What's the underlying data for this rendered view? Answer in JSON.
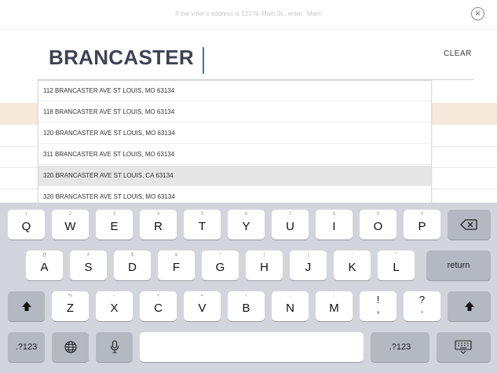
{
  "hint": {
    "text": "If the voter's address is 123 N. Main St., enter: 'Main'"
  },
  "search": {
    "value": "BRANCASTER",
    "clear_label": "CLEAR"
  },
  "suggestions": [
    "112 BRANCASTER AVE ST LOUIS, MO 63134",
    "118 BRANCASTER AVE ST LOUIS, MO 63134",
    "120 BRANCASTER AVE ST LOUIS, MO 63134",
    "311 BRANCASTER AVE ST LOUIS, MO 63134",
    "320 BRANCASTER AVE ST LOUIS, CA 63134",
    "320 BRANCASTER AVE ST LOUIS, MO 63134"
  ],
  "keyboard": {
    "row1": [
      {
        "main": "Q",
        "hint": "1"
      },
      {
        "main": "W",
        "hint": "2"
      },
      {
        "main": "E",
        "hint": "3"
      },
      {
        "main": "R",
        "hint": "4"
      },
      {
        "main": "T",
        "hint": "5"
      },
      {
        "main": "Y",
        "hint": "6"
      },
      {
        "main": "U",
        "hint": "7"
      },
      {
        "main": "I",
        "hint": "8"
      },
      {
        "main": "O",
        "hint": "9"
      },
      {
        "main": "P",
        "hint": "0"
      }
    ],
    "row2": [
      {
        "main": "A",
        "hint": "@"
      },
      {
        "main": "S",
        "hint": "#"
      },
      {
        "main": "D",
        "hint": "$"
      },
      {
        "main": "F",
        "hint": "&"
      },
      {
        "main": "G",
        "hint": "*"
      },
      {
        "main": "H",
        "hint": "("
      },
      {
        "main": "J",
        "hint": ")"
      },
      {
        "main": "K",
        "hint": "'"
      },
      {
        "main": "L",
        "hint": "\""
      }
    ],
    "row3": [
      {
        "main": "Z",
        "hint": "%"
      },
      {
        "main": "X",
        "hint": "-"
      },
      {
        "main": "C",
        "hint": "+"
      },
      {
        "main": "V",
        "hint": "="
      },
      {
        "main": "B",
        "hint": "/"
      },
      {
        "main": "N",
        "hint": ";"
      },
      {
        "main": "M",
        "hint": ":"
      },
      {
        "main": "!\n,",
        "hint": ""
      },
      {
        "main": "?\n.",
        "hint": ""
      }
    ],
    "return_label": "return",
    "numbers_label": ".?123",
    "icons": [
      "backspace-icon",
      "shift-icon",
      "globe-icon",
      "microphone-icon",
      "keyboard-dismiss-icon"
    ]
  }
}
